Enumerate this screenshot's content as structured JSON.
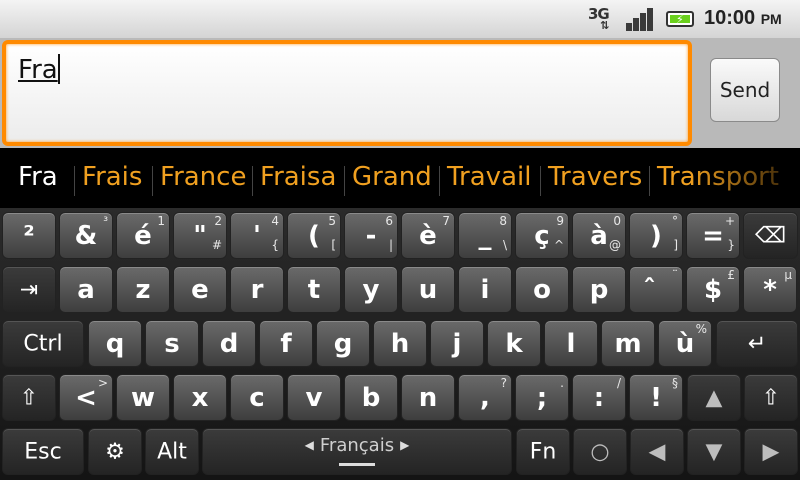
{
  "status_bar": {
    "network_label": "3G",
    "network_arrows": "⇅",
    "signal_icon": "signal-icon",
    "battery_icon": "battery-charging-icon",
    "time": "10:00",
    "time_suffix": "PM"
  },
  "compose": {
    "input_value": "Fra",
    "send_label": "Send",
    "accent_color": "#ff8a00"
  },
  "suggestions": [
    "Fra",
    "Frais",
    "France",
    "Fraisa",
    "Grand",
    "Travail",
    "Travers",
    "Transport"
  ],
  "keyboard": {
    "row1": [
      {
        "main": "²",
        "alt": ""
      },
      {
        "main": "&",
        "alt": "³"
      },
      {
        "main": "é",
        "alt": "1"
      },
      {
        "main": "\"",
        "alt": "2",
        "alt2": "#"
      },
      {
        "main": "'",
        "alt": "4",
        "alt2": "{"
      },
      {
        "main": "(",
        "alt": "5",
        "alt2": "["
      },
      {
        "main": "-",
        "alt": "6",
        "alt2": "|"
      },
      {
        "main": "è",
        "alt": "7"
      },
      {
        "main": "_",
        "alt": "8",
        "alt2": "\\"
      },
      {
        "main": "ç",
        "alt": "9",
        "alt2": "^"
      },
      {
        "main": "à",
        "alt": "0",
        "alt2": "@"
      },
      {
        "main": ")",
        "alt": "°",
        "alt2": "]"
      },
      {
        "main": "=",
        "alt": "+",
        "alt2": "}"
      }
    ],
    "row2": [
      {
        "main": "a"
      },
      {
        "main": "z"
      },
      {
        "main": "e"
      },
      {
        "main": "r"
      },
      {
        "main": "t"
      },
      {
        "main": "y"
      },
      {
        "main": "u"
      },
      {
        "main": "i"
      },
      {
        "main": "o"
      },
      {
        "main": "p"
      },
      {
        "main": "̂",
        "alt": "¨"
      },
      {
        "main": "$",
        "alt": "£"
      },
      {
        "main": "*",
        "alt": "µ"
      }
    ],
    "row3": [
      {
        "main": "q"
      },
      {
        "main": "s"
      },
      {
        "main": "d"
      },
      {
        "main": "f"
      },
      {
        "main": "g"
      },
      {
        "main": "h"
      },
      {
        "main": "j"
      },
      {
        "main": "k"
      },
      {
        "main": "l"
      },
      {
        "main": "m"
      },
      {
        "main": "ù",
        "alt": "%"
      }
    ],
    "row4": [
      {
        "main": "<",
        "alt": ">"
      },
      {
        "main": "w"
      },
      {
        "main": "x"
      },
      {
        "main": "c"
      },
      {
        "main": "v"
      },
      {
        "main": "b"
      },
      {
        "main": "n"
      },
      {
        "main": ",",
        "alt": "?"
      },
      {
        "main": ";",
        "alt": "."
      },
      {
        "main": ":",
        "alt": "/"
      },
      {
        "main": "!",
        "alt": "§"
      }
    ],
    "ctrl_label": "Ctrl",
    "esc_label": "Esc",
    "alt_label": "Alt",
    "fn_label": "Fn",
    "language_label": "Français",
    "tab_icon": "tab-icon",
    "backspace_icon": "backspace-icon",
    "enter_icon": "enter-icon",
    "shift_icon": "shift-icon",
    "settings_icon": "settings-icon",
    "arrow_up_icon": "arrow-up-icon",
    "arrow_down_icon": "arrow-down-icon",
    "arrow_left_icon": "arrow-left-icon",
    "arrow_right_icon": "arrow-right-icon",
    "center_icon": "circle-icon"
  }
}
